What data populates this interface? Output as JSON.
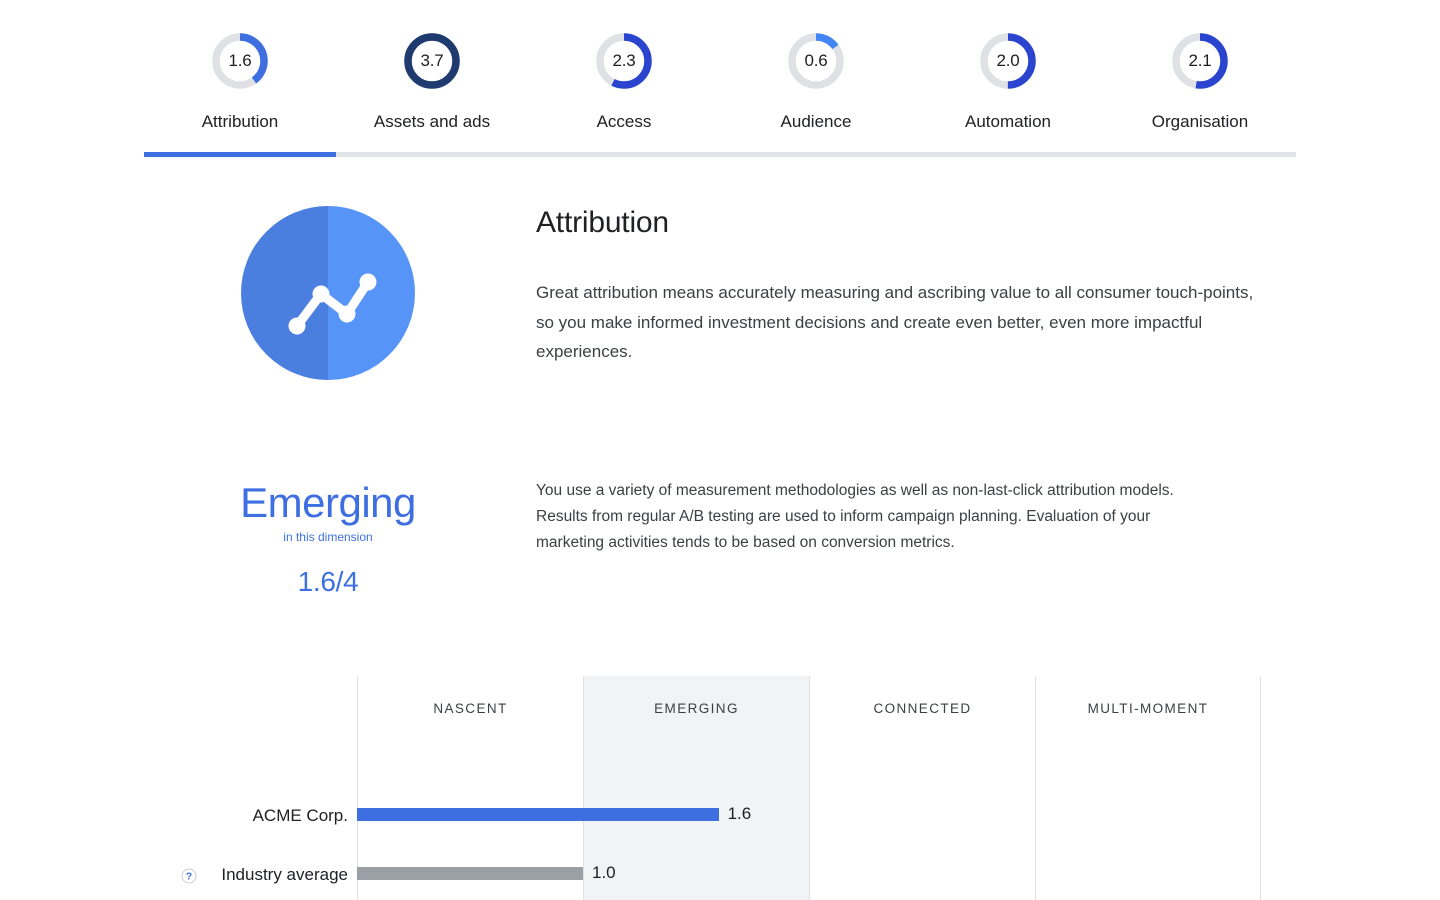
{
  "tabs": [
    {
      "label": "Attribution",
      "score": "1.6",
      "fraction": 0.4,
      "color": "#3d6fe0",
      "track": "#dfe1e5",
      "active": true
    },
    {
      "label": "Assets and ads",
      "score": "3.7",
      "fraction": 1.0,
      "color": "#1f3a6e",
      "track": "#dfe1e5",
      "active": false
    },
    {
      "label": "Access",
      "score": "2.3",
      "fraction": 0.575,
      "color": "#2b44cf",
      "track": "#dfe1e5",
      "active": false
    },
    {
      "label": "Audience",
      "score": "0.6",
      "fraction": 0.15,
      "color": "#4285f4",
      "track": "#dfe1e5",
      "active": false
    },
    {
      "label": "Automation",
      "score": "2.0",
      "fraction": 0.5,
      "color": "#2b44cf",
      "track": "#dfe1e5",
      "active": false
    },
    {
      "label": "Organisation",
      "score": "2.1",
      "fraction": 0.525,
      "color": "#2b44cf",
      "track": "#dfe1e5",
      "active": false
    }
  ],
  "hero": {
    "icon_name": "attribution-trendline-icon",
    "title": "Attribution",
    "description": "Great attribution means accurately measuring and ascribing value to all consumer touch-points, so you make informed investment decisions and create even better, even more impactful experiences."
  },
  "score": {
    "level": "Emerging",
    "level_sub": "in this dimension",
    "value": "1.6/4",
    "accent_color": "#3d6fe0",
    "description": "You use a variety of measurement methodologies as well as non-last-click attribution models. Results from regular A/B testing are used to inform campaign planning. Evaluation of your marketing activities tends to be based on conversion metrics."
  },
  "chart_data": {
    "type": "bar",
    "title": "",
    "orientation": "horizontal",
    "categories": [
      "ACME Corp.",
      "Industry average"
    ],
    "values": [
      1.6,
      1.0
    ],
    "value_labels": [
      "1.6",
      "1.0"
    ],
    "xlabel": "",
    "ylabel": "",
    "xlim": [
      0,
      4
    ],
    "grid": true,
    "stage_bands": [
      {
        "label": "NASCENT",
        "range": [
          0,
          1
        ],
        "highlighted": false
      },
      {
        "label": "EMERGING",
        "range": [
          1,
          2
        ],
        "highlighted": true
      },
      {
        "label": "CONNECTED",
        "range": [
          2,
          3
        ],
        "highlighted": false
      },
      {
        "label": "MULTI-MOMENT",
        "range": [
          3,
          4
        ],
        "highlighted": false
      }
    ],
    "series": [
      {
        "name": "ACME Corp.",
        "value": 1.6,
        "label": "1.6",
        "color": "#3d6fe0",
        "has_help_icon": false
      },
      {
        "name": "Industry average",
        "value": 1.0,
        "label": "1.0",
        "color": "#9aa0a6",
        "has_help_icon": true
      }
    ],
    "help_icon_name": "help-question-icon"
  }
}
